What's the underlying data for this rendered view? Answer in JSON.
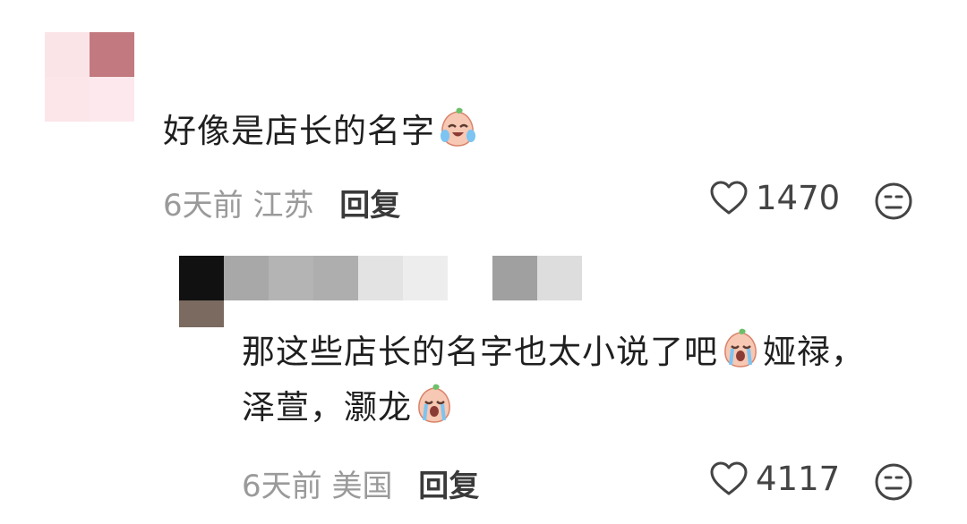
{
  "comments": [
    {
      "text": "好像是店长的名字",
      "time": "6天前",
      "location": "江苏",
      "reply_label": "回复",
      "likes": "1470",
      "emoji": "crying-laughing-peach-emoji"
    },
    {
      "text_part1": "那这些店长的名字也太小说了吧",
      "text_part2": "娅禄，泽萱，灏龙",
      "time": "6天前",
      "location": "美国",
      "reply_label": "回复",
      "likes": "4117",
      "emoji": "crying-peach-emoji"
    }
  ],
  "icons": {
    "like": "heart-outline-icon",
    "dislike": "meh-face-icon"
  },
  "colors": {
    "text": "#1f1f1f",
    "meta": "#9a9a9a",
    "reply": "#3a3a3a"
  }
}
